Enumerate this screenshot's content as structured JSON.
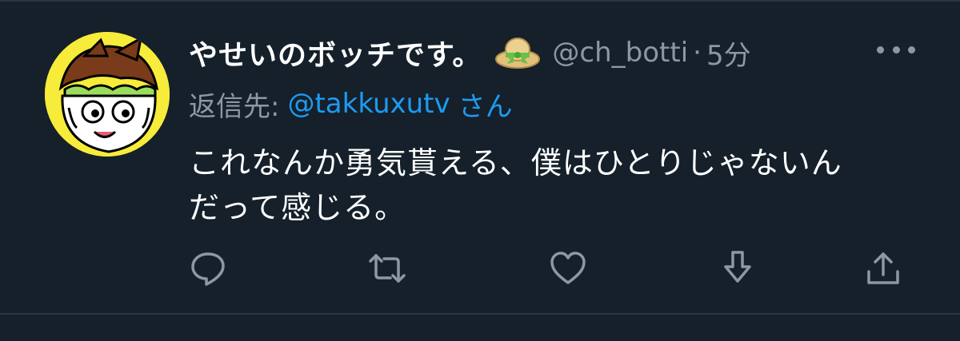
{
  "tweet": {
    "display_name": "やせいのボッチです。",
    "badge_icon": "straw-hat-icon",
    "handle": "@ch_botti",
    "separator": "·",
    "time": "5分",
    "reply_prefix": "返信先:",
    "reply_user": "@takkuxutv",
    "reply_suffix": "さん",
    "text_line1": "これなんか勇気貰える、僕はひとりじゃないん",
    "text_line2": "だって感じる。"
  },
  "actions": {
    "reply": "reply-icon",
    "retweet": "retweet-icon",
    "like": "heart-icon",
    "download": "download-icon",
    "share": "share-icon"
  },
  "colors": {
    "background": "#15202b",
    "text": "#ffffff",
    "muted": "#8b98a5",
    "link": "#1d9bf0",
    "avatar_bg": "#f7ec3a"
  }
}
